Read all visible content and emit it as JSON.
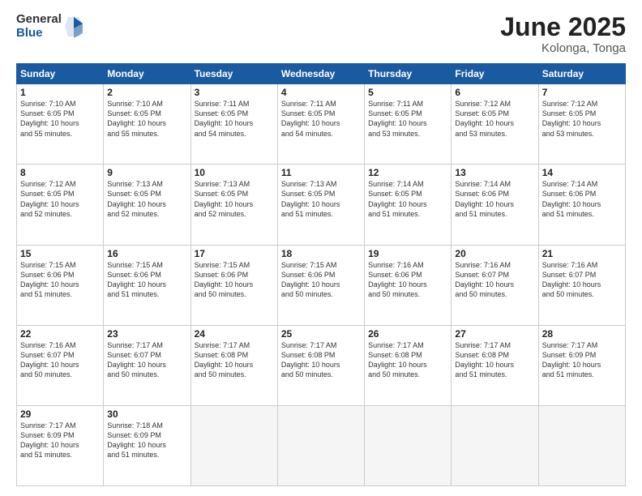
{
  "header": {
    "logo_general": "General",
    "logo_blue": "Blue",
    "month_title": "June 2025",
    "location": "Kolonga, Tonga"
  },
  "calendar": {
    "days_of_week": [
      "Sunday",
      "Monday",
      "Tuesday",
      "Wednesday",
      "Thursday",
      "Friday",
      "Saturday"
    ],
    "weeks": [
      [
        {
          "day": "",
          "info": ""
        },
        {
          "day": "2",
          "info": "Sunrise: 7:10 AM\nSunset: 6:05 PM\nDaylight: 10 hours\nand 55 minutes."
        },
        {
          "day": "3",
          "info": "Sunrise: 7:11 AM\nSunset: 6:05 PM\nDaylight: 10 hours\nand 54 minutes."
        },
        {
          "day": "4",
          "info": "Sunrise: 7:11 AM\nSunset: 6:05 PM\nDaylight: 10 hours\nand 54 minutes."
        },
        {
          "day": "5",
          "info": "Sunrise: 7:11 AM\nSunset: 6:05 PM\nDaylight: 10 hours\nand 53 minutes."
        },
        {
          "day": "6",
          "info": "Sunrise: 7:12 AM\nSunset: 6:05 PM\nDaylight: 10 hours\nand 53 minutes."
        },
        {
          "day": "7",
          "info": "Sunrise: 7:12 AM\nSunset: 6:05 PM\nDaylight: 10 hours\nand 53 minutes."
        }
      ],
      [
        {
          "day": "1",
          "info": "Sunrise: 7:10 AM\nSunset: 6:05 PM\nDaylight: 10 hours\nand 55 minutes."
        },
        {
          "day": "9",
          "info": "Sunrise: 7:13 AM\nSunset: 6:05 PM\nDaylight: 10 hours\nand 52 minutes."
        },
        {
          "day": "10",
          "info": "Sunrise: 7:13 AM\nSunset: 6:05 PM\nDaylight: 10 hours\nand 52 minutes."
        },
        {
          "day": "11",
          "info": "Sunrise: 7:13 AM\nSunset: 6:05 PM\nDaylight: 10 hours\nand 51 minutes."
        },
        {
          "day": "12",
          "info": "Sunrise: 7:14 AM\nSunset: 6:05 PM\nDaylight: 10 hours\nand 51 minutes."
        },
        {
          "day": "13",
          "info": "Sunrise: 7:14 AM\nSunset: 6:06 PM\nDaylight: 10 hours\nand 51 minutes."
        },
        {
          "day": "14",
          "info": "Sunrise: 7:14 AM\nSunset: 6:06 PM\nDaylight: 10 hours\nand 51 minutes."
        }
      ],
      [
        {
          "day": "8",
          "info": "Sunrise: 7:12 AM\nSunset: 6:05 PM\nDaylight: 10 hours\nand 52 minutes."
        },
        {
          "day": "16",
          "info": "Sunrise: 7:15 AM\nSunset: 6:06 PM\nDaylight: 10 hours\nand 51 minutes."
        },
        {
          "day": "17",
          "info": "Sunrise: 7:15 AM\nSunset: 6:06 PM\nDaylight: 10 hours\nand 50 minutes."
        },
        {
          "day": "18",
          "info": "Sunrise: 7:15 AM\nSunset: 6:06 PM\nDaylight: 10 hours\nand 50 minutes."
        },
        {
          "day": "19",
          "info": "Sunrise: 7:16 AM\nSunset: 6:06 PM\nDaylight: 10 hours\nand 50 minutes."
        },
        {
          "day": "20",
          "info": "Sunrise: 7:16 AM\nSunset: 6:07 PM\nDaylight: 10 hours\nand 50 minutes."
        },
        {
          "day": "21",
          "info": "Sunrise: 7:16 AM\nSunset: 6:07 PM\nDaylight: 10 hours\nand 50 minutes."
        }
      ],
      [
        {
          "day": "15",
          "info": "Sunrise: 7:15 AM\nSunset: 6:06 PM\nDaylight: 10 hours\nand 51 minutes."
        },
        {
          "day": "23",
          "info": "Sunrise: 7:17 AM\nSunset: 6:07 PM\nDaylight: 10 hours\nand 50 minutes."
        },
        {
          "day": "24",
          "info": "Sunrise: 7:17 AM\nSunset: 6:08 PM\nDaylight: 10 hours\nand 50 minutes."
        },
        {
          "day": "25",
          "info": "Sunrise: 7:17 AM\nSunset: 6:08 PM\nDaylight: 10 hours\nand 50 minutes."
        },
        {
          "day": "26",
          "info": "Sunrise: 7:17 AM\nSunset: 6:08 PM\nDaylight: 10 hours\nand 50 minutes."
        },
        {
          "day": "27",
          "info": "Sunrise: 7:17 AM\nSunset: 6:08 PM\nDaylight: 10 hours\nand 51 minutes."
        },
        {
          "day": "28",
          "info": "Sunrise: 7:17 AM\nSunset: 6:09 PM\nDaylight: 10 hours\nand 51 minutes."
        }
      ],
      [
        {
          "day": "22",
          "info": "Sunrise: 7:16 AM\nSunset: 6:07 PM\nDaylight: 10 hours\nand 50 minutes."
        },
        {
          "day": "30",
          "info": "Sunrise: 7:18 AM\nSunset: 6:09 PM\nDaylight: 10 hours\nand 51 minutes."
        },
        {
          "day": "",
          "info": ""
        },
        {
          "day": "",
          "info": ""
        },
        {
          "day": "",
          "info": ""
        },
        {
          "day": "",
          "info": ""
        },
        {
          "day": "",
          "info": ""
        }
      ],
      [
        {
          "day": "29",
          "info": "Sunrise: 7:17 AM\nSunset: 6:09 PM\nDaylight: 10 hours\nand 51 minutes."
        },
        {
          "day": "",
          "info": ""
        },
        {
          "day": "",
          "info": ""
        },
        {
          "day": "",
          "info": ""
        },
        {
          "day": "",
          "info": ""
        },
        {
          "day": "",
          "info": ""
        },
        {
          "day": "",
          "info": ""
        }
      ]
    ]
  }
}
